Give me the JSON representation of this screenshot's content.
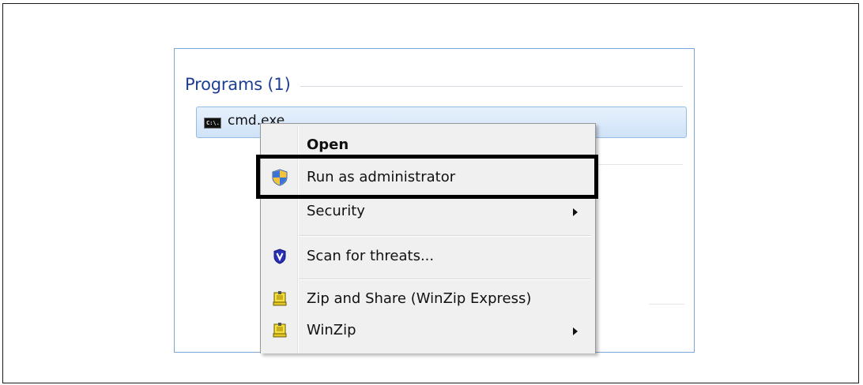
{
  "search_results": {
    "heading": "Programs (1)",
    "item": {
      "label": "cmd.exe",
      "icon": "cmd-icon",
      "icon_text": "C:\\."
    }
  },
  "context_menu": {
    "items": [
      {
        "label": "Open",
        "bold": true
      },
      {
        "label": "Run as administrator",
        "icon": "uac-shield-icon",
        "highlighted": true
      },
      {
        "label": "Security",
        "submenu": true
      },
      {
        "label": "Scan for threats...",
        "icon": "antivirus-shield-icon"
      },
      {
        "label": "Zip and Share (WinZip Express)",
        "icon": "winzip-icon"
      },
      {
        "label": "WinZip",
        "icon": "winzip-icon",
        "submenu": true
      }
    ]
  },
  "colors": {
    "heading": "#1e3f91",
    "selection_border": "#94bde6",
    "highlight_box": "#000000",
    "panel_border": "#7aa7d8"
  }
}
